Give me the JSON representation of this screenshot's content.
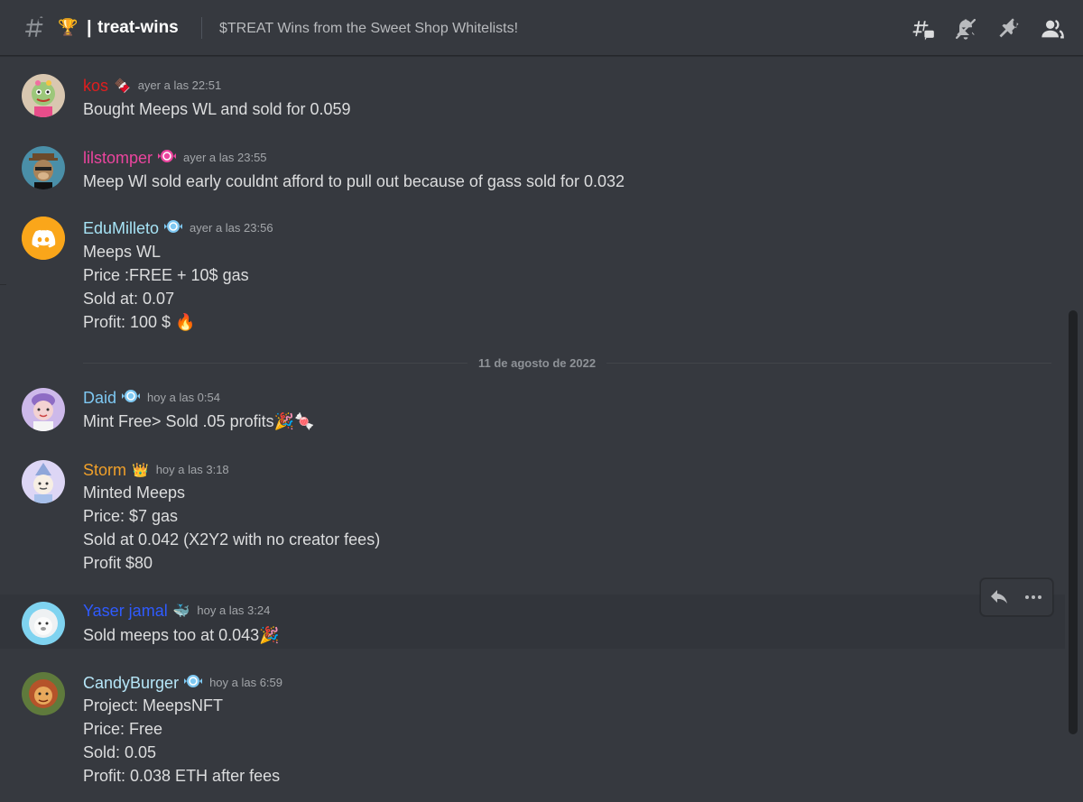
{
  "header": {
    "channel_name": "treat-wins",
    "separator": "|",
    "topic": "$TREAT Wins from the Sweet Shop Whitelists!",
    "icons": [
      "threads-icon",
      "mute-bell-icon",
      "pin-icon",
      "members-icon"
    ]
  },
  "date_divider": "11 de agosto de 2022",
  "messages": [
    {
      "username": "kos",
      "color": "#e01e1e",
      "timestamp": "ayer a las 22:51",
      "lines": [
        "Bought Meeps WL and sold for 0.059"
      ]
    },
    {
      "username": "lilstomper",
      "color": "#eb459e",
      "timestamp": "ayer a las 23:55",
      "lines": [
        "Meep Wl sold early couldnt afford to pull out because of gass sold for 0.032"
      ]
    },
    {
      "username": "EduMilleto",
      "color": "#a6e3f5",
      "timestamp": "ayer a las 23:56",
      "lines": [
        "Meeps WL",
        "Price :FREE + 10$ gas",
        "Sold at: 0.07",
        "Profit: 100 $ 🔥"
      ]
    },
    {
      "username": "Daid",
      "color": "#7ec8f2",
      "timestamp": "hoy a las 0:54",
      "lines": [
        "Mint Free> Sold .05 profits🎉🍬"
      ]
    },
    {
      "username": "Storm",
      "color": "#f0a02a",
      "timestamp": "hoy a las 3:18",
      "lines": [
        "Minted Meeps",
        "Price: $7 gas",
        "Sold at 0.042 (X2Y2 with no creator fees)",
        "Profit $80"
      ]
    },
    {
      "username": "Yaser jamal",
      "color": "#2f5bff",
      "timestamp": "hoy a las 3:24",
      "lines": [
        "Sold meeps too at 0.043🎉"
      ]
    },
    {
      "username": "CandyBurger",
      "color": "#b6e6f8",
      "timestamp": "hoy a las 6:59",
      "lines": [
        "Project: MeepsNFT",
        "Price: Free",
        "Sold: 0.05",
        "Profit: 0.038 ETH after fees"
      ]
    }
  ],
  "message_actions": [
    "reply-icon",
    "more-icon"
  ]
}
